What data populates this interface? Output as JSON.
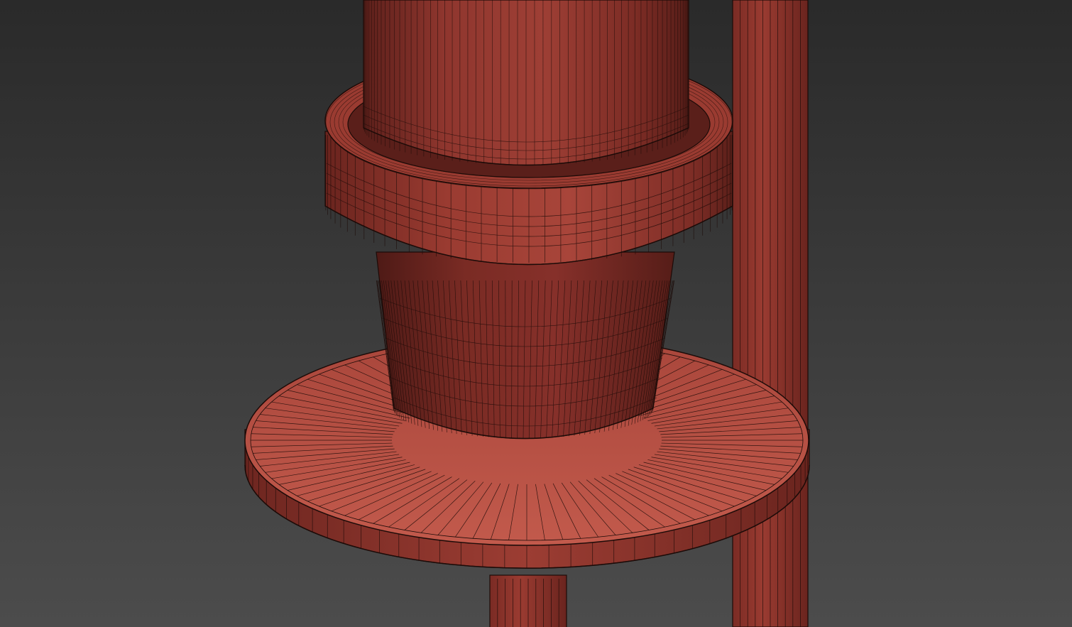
{
  "viewport": {
    "background_top": "#2a2a2a",
    "background_bottom": "#4c4c4c"
  },
  "model": {
    "shaded_color": "#a8453a",
    "dark_color": "#6e2620",
    "light_color": "#c0574a",
    "wire_color": "#1c0b08"
  },
  "objects": [
    {
      "name": "upper-cylinder"
    },
    {
      "name": "ring-collar"
    },
    {
      "name": "tapered-pot"
    },
    {
      "name": "round-plate"
    },
    {
      "name": "vertical-pole"
    },
    {
      "name": "lower-stem"
    }
  ]
}
